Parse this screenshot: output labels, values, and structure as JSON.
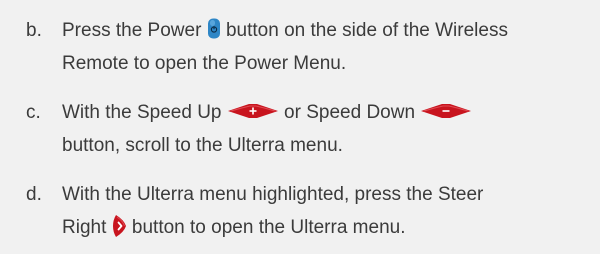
{
  "steps": [
    {
      "letter": "b.",
      "line1_pre": "Press the Power",
      "line1_post": "button on the side of the Wireless",
      "line2": "Remote to open the Power Menu."
    },
    {
      "letter": "c.",
      "line1_pre": "With the Speed Up",
      "line1_mid": "or Speed Down",
      "line2": "button, scroll to the Ulterra menu."
    },
    {
      "letter": "d.",
      "line1": "With the Ulterra menu highlighted, press the Steer",
      "line2_pre": "Right",
      "line2_post": "button to open the Ulterra menu."
    }
  ],
  "icons": {
    "power": "power-button-icon",
    "speed_up": "speed-up-button-icon",
    "speed_down": "speed-down-button-icon",
    "steer_right": "steer-right-button-icon"
  },
  "colors": {
    "background": "#f1f1f1",
    "text": "#3b3b3b",
    "power_button": "#2e86c6",
    "speed_button": "#c8141e",
    "steer_button": "#c8141e"
  }
}
